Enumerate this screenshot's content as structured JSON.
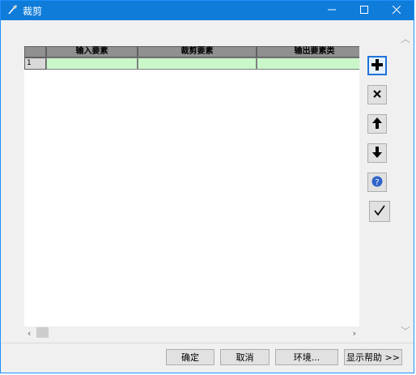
{
  "window": {
    "title": "裁剪",
    "controls": {
      "minimize": "minimize",
      "maximize": "maximize",
      "close": "close"
    }
  },
  "grid": {
    "columns": [
      "输入要素",
      "裁剪要素",
      "输出要素类"
    ],
    "rows": [
      {
        "index": "1",
        "cells": [
          "",
          "",
          ""
        ]
      }
    ]
  },
  "side_buttons": [
    {
      "name": "add-row-button",
      "icon": "plus-icon"
    },
    {
      "name": "delete-row-button",
      "icon": "close-icon"
    },
    {
      "name": "move-up-button",
      "icon": "arrow-up-icon"
    },
    {
      "name": "move-down-button",
      "icon": "arrow-down-icon"
    },
    {
      "name": "help-button",
      "icon": "help-icon"
    },
    {
      "name": "check-button",
      "icon": "checkmark-icon"
    }
  ],
  "footer": {
    "ok": "确定",
    "cancel": "取消",
    "environments": "环境...",
    "show_help": "显示帮助 >>"
  },
  "colors": {
    "titlebar": "#0f7cd9",
    "row_fill": "#c9f7c9",
    "header_fill": "#909090"
  }
}
